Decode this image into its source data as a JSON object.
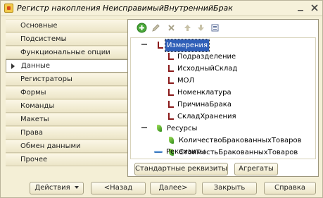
{
  "window": {
    "title": "Регистр накопления НеисправимыйВнутреннийБрак",
    "icon": "register-icon"
  },
  "nav": {
    "items": [
      {
        "label": "Основные"
      },
      {
        "label": "Подсистемы"
      },
      {
        "label": "Функциональные опции"
      },
      {
        "label": "Данные"
      },
      {
        "label": "Регистраторы"
      },
      {
        "label": "Формы"
      },
      {
        "label": "Команды"
      },
      {
        "label": "Макеты"
      },
      {
        "label": "Права"
      },
      {
        "label": "Обмен данными"
      },
      {
        "label": "Прочее"
      }
    ],
    "active_index": 3
  },
  "toolbar": {
    "buttons": [
      {
        "icon": "add-icon",
        "color": "#3a9a2a"
      },
      {
        "icon": "edit-icon"
      },
      {
        "icon": "delete-icon"
      },
      {
        "icon": "move-up-icon"
      },
      {
        "icon": "move-down-icon"
      },
      {
        "icon": "sort-icon"
      }
    ]
  },
  "tree": {
    "dimensions": {
      "label": "Измерения",
      "children": [
        {
          "label": "Подразделение"
        },
        {
          "label": "ИсходныйСклад"
        },
        {
          "label": "МОЛ"
        },
        {
          "label": "Номенклатура"
        },
        {
          "label": "ПричинаБрака"
        },
        {
          "label": "СкладХранения"
        }
      ]
    },
    "resources": {
      "label": "Ресурсы",
      "children": [
        {
          "label": "КоличествоБракованныхТоваров"
        },
        {
          "label": "СтоимостьБракованныхТоваров"
        }
      ]
    },
    "attributes": {
      "label": "Реквизиты"
    }
  },
  "panel_buttons": {
    "standard_attributes": "Стандартные реквизиты",
    "aggregates": "Агрегаты"
  },
  "footer": {
    "actions": "Действия",
    "back": "<Назад",
    "next": "Далее>",
    "close": "Закрыть",
    "help": "Справка"
  },
  "colors": {
    "window_bg": "#f4efd6",
    "selection": "#2f5fb8",
    "dimension_icon": "#8a1a1a",
    "resource_icon": "#3a9a2a"
  }
}
